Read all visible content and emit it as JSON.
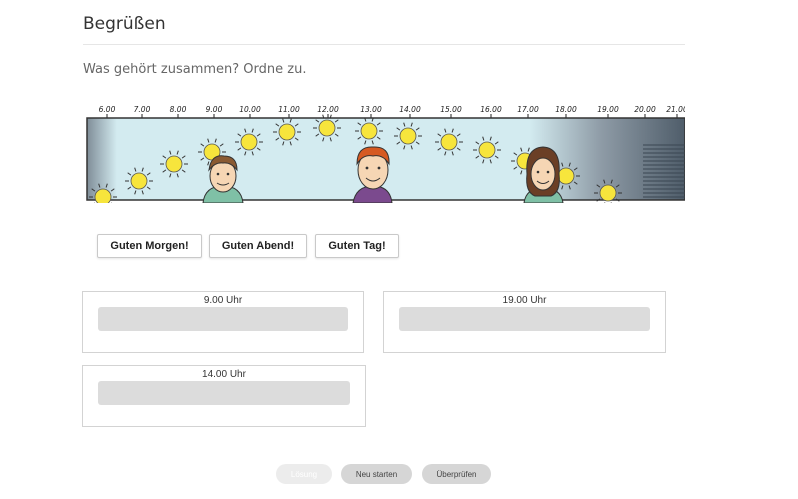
{
  "header": {
    "title": "Begrüßen"
  },
  "task": {
    "instruction": "Was gehört zusammen? Ordne zu."
  },
  "illustration": {
    "time_labels": [
      "6.00",
      "7.00",
      "8.00",
      "9.00",
      "10.00",
      "11.00",
      "12.00",
      "13.00",
      "14.00",
      "15.00",
      "16.00",
      "17.00",
      "18.00",
      "19.00",
      "20.00",
      "21.00"
    ],
    "colors": {
      "sky": "#d3ebf0",
      "sun": "#f7e53c",
      "sun_rays": "#333333",
      "night": "#5d6b78"
    }
  },
  "tiles": [
    {
      "label": "Guten Morgen!"
    },
    {
      "label": "Guten Abend!"
    },
    {
      "label": "Guten Tag!"
    }
  ],
  "drop_targets": [
    {
      "label": "9.00 Uhr"
    },
    {
      "label": "19.00 Uhr"
    },
    {
      "label": "14.00 Uhr"
    }
  ],
  "buttons": {
    "solution": "Lösung",
    "restart": "Neu starten",
    "check": "Überprüfen"
  }
}
